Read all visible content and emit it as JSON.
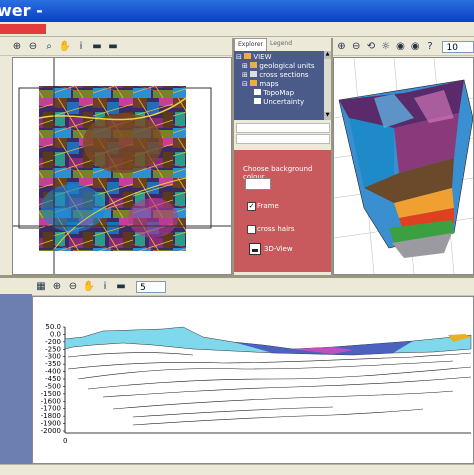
{
  "window": {
    "title": "wer -"
  },
  "top_left_toolbar": {
    "icons": [
      "zoom-in-icon",
      "zoom-out-icon",
      "zoom-fit-icon",
      "pan-hand-icon",
      "info-icon",
      "book-icon",
      "book2-icon"
    ]
  },
  "explorer": {
    "tabs": [
      "Explorer",
      "Legend"
    ],
    "tree": [
      {
        "label": "VIEW",
        "indent": 0
      },
      {
        "label": "geological units",
        "indent": 1
      },
      {
        "label": "cross sections",
        "indent": 1
      },
      {
        "label": "maps",
        "indent": 1
      },
      {
        "label": "TopoMap",
        "indent": 2
      },
      {
        "label": "Uncertainty",
        "indent": 2
      }
    ]
  },
  "options": {
    "background_label": "Choose background colour",
    "frame_label": "Frame",
    "frame_checked": true,
    "cross_hairs_label": "cross hairs",
    "cross_hairs_checked": false,
    "view3d_label": "3D-View"
  },
  "right_toolbar": {
    "zoom_value": "10"
  },
  "section_toolbar": {
    "value": "5"
  },
  "section_chart": {
    "y_ticks": [
      "50.0",
      "0.0",
      "-200",
      "-250",
      "-300",
      "-350",
      "-400",
      "-450",
      "-500",
      "-1500",
      "-1600",
      "-1700",
      "-1800",
      "-1900",
      "-2000"
    ],
    "x_ticks": [
      "0"
    ]
  },
  "colors": {
    "accent": "#c85a5e",
    "title_bar": "#0a3ec4",
    "explorer_bg": "#4a5b8a"
  }
}
